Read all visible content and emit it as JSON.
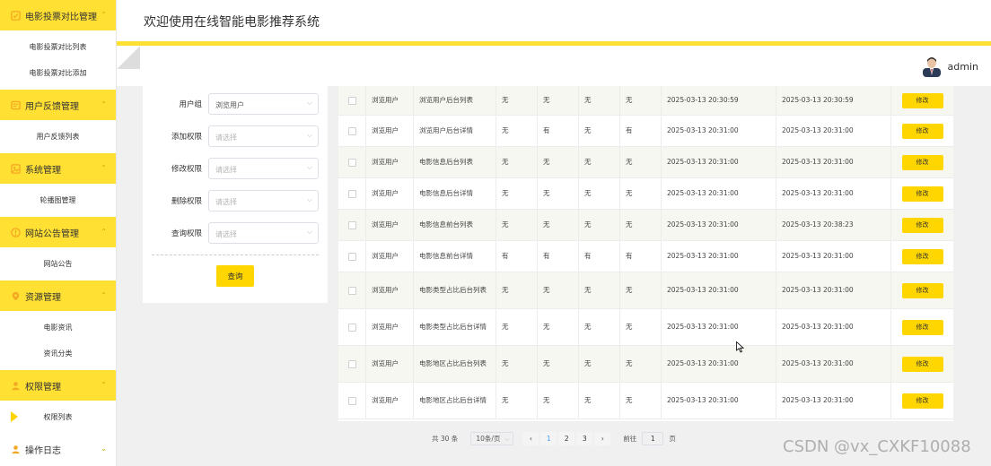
{
  "sidebar": {
    "groups": [
      {
        "label": "电影投票对比管理",
        "items": [
          "电影投票对比列表",
          "电影投票对比添加"
        ]
      },
      {
        "label": "用户反馈管理",
        "items": [
          "用户反馈列表"
        ]
      },
      {
        "label": "系统管理",
        "items": [
          "轮播图管理"
        ]
      },
      {
        "label": "网站公告管理",
        "items": [
          "网站公告"
        ]
      },
      {
        "label": "资源管理",
        "items": [
          "电影资讯",
          "资讯分类"
        ]
      },
      {
        "label": "权限管理",
        "items": [
          "权限列表"
        ]
      },
      {
        "label": "操作日志",
        "items": []
      }
    ]
  },
  "header": {
    "title": "欢迎使用在线智能电影推荐系统"
  },
  "user": {
    "name": "admin"
  },
  "form": {
    "fields": [
      {
        "label": "用户组",
        "value": "浏览用户",
        "placeholder": ""
      },
      {
        "label": "添加权限",
        "value": "",
        "placeholder": "请选择"
      },
      {
        "label": "修改权限",
        "value": "",
        "placeholder": "请选择"
      },
      {
        "label": "删除权限",
        "value": "",
        "placeholder": "请选择"
      },
      {
        "label": "查询权限",
        "value": "",
        "placeholder": "请选择"
      }
    ],
    "query_label": "查询"
  },
  "table": {
    "edit_label": "修改",
    "rows": [
      [
        "浏览用户",
        "浏览用户后台列表",
        "无",
        "无",
        "无",
        "无",
        "2025-03-13 20:30:59",
        "2025-03-13 20:30:59"
      ],
      [
        "浏览用户",
        "浏览用户后台详情",
        "无",
        "有",
        "无",
        "有",
        "2025-03-13 20:31:00",
        "2025-03-13 20:31:00"
      ],
      [
        "浏览用户",
        "电影信息后台列表",
        "无",
        "无",
        "无",
        "无",
        "2025-03-13 20:31:00",
        "2025-03-13 20:31:00"
      ],
      [
        "浏览用户",
        "电影信息后台详情",
        "无",
        "无",
        "无",
        "无",
        "2025-03-13 20:31:00",
        "2025-03-13 20:31:00"
      ],
      [
        "浏览用户",
        "电影信息前台列表",
        "无",
        "无",
        "无",
        "无",
        "2025-03-13 20:31:00",
        "2025-03-13 20:38:23"
      ],
      [
        "浏览用户",
        "电影信息前台详情",
        "有",
        "有",
        "有",
        "有",
        "2025-03-13 20:31:00",
        "2025-03-13 20:31:00"
      ],
      [
        "浏览用户",
        "电影类型占比后台列表",
        "无",
        "无",
        "无",
        "无",
        "2025-03-13 20:31:00",
        "2025-03-13 20:31:00"
      ],
      [
        "浏览用户",
        "电影类型占比后台详情",
        "无",
        "无",
        "无",
        "无",
        "2025-03-13 20:31:00",
        "2025-03-13 20:31:00"
      ],
      [
        "浏览用户",
        "电影地区占比后台列表",
        "无",
        "无",
        "无",
        "无",
        "2025-03-13 20:31:00",
        "2025-03-13 20:31:00"
      ],
      [
        "浏览用户",
        "电影地区占比后台详情",
        "无",
        "无",
        "无",
        "无",
        "2025-03-13 20:31:00",
        "2025-03-13 20:31:00"
      ]
    ]
  },
  "pagination": {
    "total": "共 30 条",
    "page_size": "10条/页",
    "pages": [
      "1",
      "2",
      "3"
    ],
    "prev": "‹",
    "next": "›",
    "goto_label": "前往",
    "goto_value": "1",
    "page_unit": "页"
  },
  "watermark": "CSDN @vx_CXKF10088",
  "colors": {
    "accent": "#ffe033",
    "button": "#ffd600"
  }
}
